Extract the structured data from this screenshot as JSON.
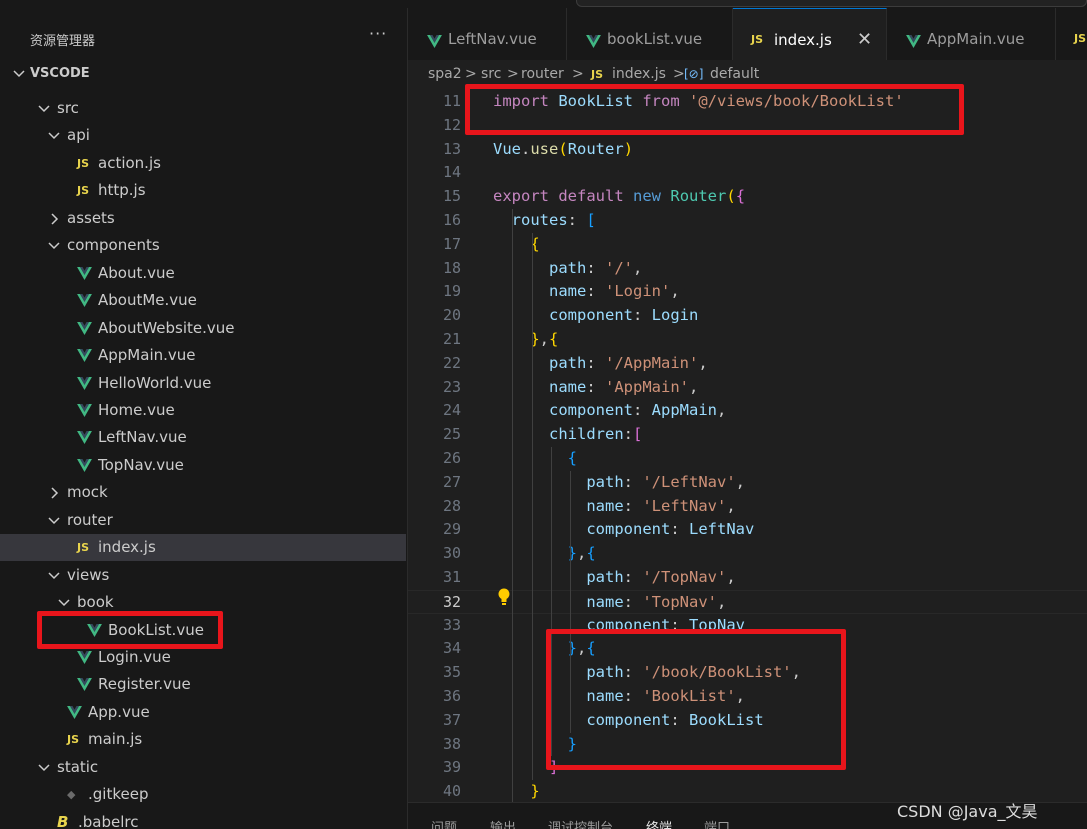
{
  "sidebar": {
    "title": "资源管理器",
    "more_label": "···",
    "workspace": "VSCODE",
    "tree": [
      {
        "label": "src",
        "kind": "folder",
        "expanded": true
      },
      {
        "label": "api",
        "kind": "folder",
        "expanded": true
      },
      {
        "label": "action.js",
        "kind": "js",
        "icon_text": "JS"
      },
      {
        "label": "http.js",
        "kind": "js",
        "icon_text": "JS"
      },
      {
        "label": "assets",
        "kind": "folder",
        "expanded": false
      },
      {
        "label": "components",
        "kind": "folder",
        "expanded": true
      },
      {
        "label": "About.vue",
        "kind": "vue"
      },
      {
        "label": "AboutMe.vue",
        "kind": "vue"
      },
      {
        "label": "AboutWebsite.vue",
        "kind": "vue"
      },
      {
        "label": "AppMain.vue",
        "kind": "vue"
      },
      {
        "label": "HelloWorld.vue",
        "kind": "vue"
      },
      {
        "label": "Home.vue",
        "kind": "vue"
      },
      {
        "label": "LeftNav.vue",
        "kind": "vue"
      },
      {
        "label": "TopNav.vue",
        "kind": "vue"
      },
      {
        "label": "mock",
        "kind": "folder",
        "expanded": false
      },
      {
        "label": "router",
        "kind": "folder",
        "expanded": true
      },
      {
        "label": "index.js",
        "kind": "js",
        "icon_text": "JS",
        "active": true
      },
      {
        "label": "views",
        "kind": "folder",
        "expanded": true
      },
      {
        "label": "book",
        "kind": "folder",
        "expanded": true
      },
      {
        "label": "BookList.vue",
        "kind": "vue"
      },
      {
        "label": "Login.vue",
        "kind": "vue"
      },
      {
        "label": "Register.vue",
        "kind": "vue"
      },
      {
        "label": "App.vue",
        "kind": "vue"
      },
      {
        "label": "main.js",
        "kind": "js",
        "icon_text": "JS"
      },
      {
        "label": "static",
        "kind": "folder",
        "expanded": true
      },
      {
        "label": ".gitkeep",
        "kind": "git",
        "icon_text": "◆"
      },
      {
        "label": ".babelrc",
        "kind": "babel",
        "icon_text": "B"
      }
    ]
  },
  "tabs": [
    {
      "label": "LeftNav.vue",
      "kind": "vue",
      "active": false
    },
    {
      "label": "bookList.vue",
      "kind": "vue",
      "active": false
    },
    {
      "label": "index.js",
      "kind": "js",
      "icon_text": "JS",
      "active": true,
      "close": "✕"
    },
    {
      "label": "AppMain.vue",
      "kind": "vue",
      "active": false
    },
    {
      "label": "",
      "kind": "js",
      "icon_text": "JS",
      "active": false
    }
  ],
  "breadcrumb": {
    "parts": [
      "spa2",
      "src",
      "router"
    ],
    "separator": ">",
    "file_icon": "JS",
    "file": "index.js",
    "symbol_icon": "[⊘]",
    "symbol": "default"
  },
  "editor": {
    "current_line": 32,
    "lines": [
      {
        "n": "11",
        "tokens": [
          [
            "kw",
            "import"
          ],
          [
            "pun",
            " "
          ],
          [
            "id",
            "BookList"
          ],
          [
            "pun",
            " "
          ],
          [
            "kw",
            "from"
          ],
          [
            "pun",
            " "
          ],
          [
            "str",
            "'@/views/book/BookList'"
          ]
        ]
      },
      {
        "n": "12",
        "tokens": []
      },
      {
        "n": "13",
        "tokens": [
          [
            "id",
            "Vue"
          ],
          [
            "pun",
            "."
          ],
          [
            "fn",
            "use"
          ],
          [
            "br1",
            "("
          ],
          [
            "id",
            "Router"
          ],
          [
            "br1",
            ")"
          ]
        ]
      },
      {
        "n": "14",
        "tokens": []
      },
      {
        "n": "15",
        "tokens": [
          [
            "kw",
            "export"
          ],
          [
            "pun",
            " "
          ],
          [
            "kw",
            "default"
          ],
          [
            "pun",
            " "
          ],
          [
            "kw2",
            "new"
          ],
          [
            "pun",
            " "
          ],
          [
            "cls",
            "Router"
          ],
          [
            "br1",
            "("
          ],
          [
            "br2",
            "{"
          ]
        ]
      },
      {
        "n": "16",
        "tokens": [
          [
            "pun",
            "  "
          ],
          [
            "id",
            "routes"
          ],
          [
            "pun",
            ": "
          ],
          [
            "br3",
            "["
          ]
        ]
      },
      {
        "n": "17",
        "tokens": [
          [
            "pun",
            "    "
          ],
          [
            "br1",
            "{"
          ]
        ]
      },
      {
        "n": "18",
        "tokens": [
          [
            "pun",
            "      "
          ],
          [
            "id",
            "path"
          ],
          [
            "pun",
            ": "
          ],
          [
            "str",
            "'/'"
          ],
          [
            "pun",
            ","
          ]
        ]
      },
      {
        "n": "19",
        "tokens": [
          [
            "pun",
            "      "
          ],
          [
            "id",
            "name"
          ],
          [
            "pun",
            ": "
          ],
          [
            "str",
            "'Login'"
          ],
          [
            "pun",
            ","
          ]
        ]
      },
      {
        "n": "20",
        "tokens": [
          [
            "pun",
            "      "
          ],
          [
            "id",
            "component"
          ],
          [
            "pun",
            ": "
          ],
          [
            "id",
            "Login"
          ]
        ]
      },
      {
        "n": "21",
        "tokens": [
          [
            "pun",
            "    "
          ],
          [
            "br1",
            "}"
          ],
          [
            "pun",
            ","
          ],
          [
            "br1",
            "{"
          ]
        ]
      },
      {
        "n": "22",
        "tokens": [
          [
            "pun",
            "      "
          ],
          [
            "id",
            "path"
          ],
          [
            "pun",
            ": "
          ],
          [
            "str",
            "'/AppMain'"
          ],
          [
            "pun",
            ","
          ]
        ]
      },
      {
        "n": "23",
        "tokens": [
          [
            "pun",
            "      "
          ],
          [
            "id",
            "name"
          ],
          [
            "pun",
            ": "
          ],
          [
            "str",
            "'AppMain'"
          ],
          [
            "pun",
            ","
          ]
        ]
      },
      {
        "n": "24",
        "tokens": [
          [
            "pun",
            "      "
          ],
          [
            "id",
            "component"
          ],
          [
            "pun",
            ": "
          ],
          [
            "id",
            "AppMain"
          ],
          [
            "pun",
            ","
          ]
        ]
      },
      {
        "n": "25",
        "tokens": [
          [
            "pun",
            "      "
          ],
          [
            "id",
            "children"
          ],
          [
            "pun",
            ":"
          ],
          [
            "br2",
            "["
          ]
        ]
      },
      {
        "n": "26",
        "tokens": [
          [
            "pun",
            "        "
          ],
          [
            "br3",
            "{"
          ]
        ]
      },
      {
        "n": "27",
        "tokens": [
          [
            "pun",
            "          "
          ],
          [
            "id",
            "path"
          ],
          [
            "pun",
            ": "
          ],
          [
            "str",
            "'/LeftNav'"
          ],
          [
            "pun",
            ","
          ]
        ]
      },
      {
        "n": "28",
        "tokens": [
          [
            "pun",
            "          "
          ],
          [
            "id",
            "name"
          ],
          [
            "pun",
            ": "
          ],
          [
            "str",
            "'LeftNav'"
          ],
          [
            "pun",
            ","
          ]
        ]
      },
      {
        "n": "29",
        "tokens": [
          [
            "pun",
            "          "
          ],
          [
            "id",
            "component"
          ],
          [
            "pun",
            ": "
          ],
          [
            "id",
            "LeftNav"
          ]
        ]
      },
      {
        "n": "30",
        "tokens": [
          [
            "pun",
            "        "
          ],
          [
            "br3",
            "}"
          ],
          [
            "pun",
            ","
          ],
          [
            "br3",
            "{"
          ]
        ]
      },
      {
        "n": "31",
        "tokens": [
          [
            "pun",
            "          "
          ],
          [
            "id",
            "path"
          ],
          [
            "pun",
            ": "
          ],
          [
            "str",
            "'/TopNav'"
          ],
          [
            "pun",
            ","
          ]
        ]
      },
      {
        "n": "32",
        "tokens": [
          [
            "pun",
            "          "
          ],
          [
            "id",
            "name"
          ],
          [
            "pun",
            ": "
          ],
          [
            "str",
            "'TopNav'"
          ],
          [
            "pun",
            ","
          ]
        ]
      },
      {
        "n": "33",
        "tokens": [
          [
            "pun",
            "          "
          ],
          [
            "id",
            "component"
          ],
          [
            "pun",
            ": "
          ],
          [
            "id",
            "TopNav"
          ]
        ]
      },
      {
        "n": "34",
        "tokens": [
          [
            "pun",
            "        "
          ],
          [
            "br3",
            "}"
          ],
          [
            "pun",
            ","
          ],
          [
            "br3",
            "{"
          ]
        ]
      },
      {
        "n": "35",
        "tokens": [
          [
            "pun",
            "          "
          ],
          [
            "id",
            "path"
          ],
          [
            "pun",
            ": "
          ],
          [
            "str",
            "'/book/BookList'"
          ],
          [
            "pun",
            ","
          ]
        ]
      },
      {
        "n": "36",
        "tokens": [
          [
            "pun",
            "          "
          ],
          [
            "id",
            "name"
          ],
          [
            "pun",
            ": "
          ],
          [
            "str",
            "'BookList'"
          ],
          [
            "pun",
            ","
          ]
        ]
      },
      {
        "n": "37",
        "tokens": [
          [
            "pun",
            "          "
          ],
          [
            "id",
            "component"
          ],
          [
            "pun",
            ": "
          ],
          [
            "id",
            "BookList"
          ]
        ]
      },
      {
        "n": "38",
        "tokens": [
          [
            "pun",
            "        "
          ],
          [
            "br3",
            "}"
          ]
        ]
      },
      {
        "n": "39",
        "tokens": [
          [
            "pun",
            "      "
          ],
          [
            "br2",
            "]"
          ]
        ]
      },
      {
        "n": "40",
        "tokens": [
          [
            "pun",
            "    "
          ],
          [
            "br1",
            "}"
          ]
        ]
      }
    ]
  },
  "panel": {
    "tabs": [
      "问题",
      "输出",
      "调试控制台",
      "终端",
      "端口"
    ]
  },
  "watermark": "CSDN @Java_文昊",
  "colors": {
    "annotation_red": "#e8151b",
    "vue_green": "#41b883",
    "js_yellow": "#e8d44d",
    "active_tab_border": "#0078d4"
  }
}
